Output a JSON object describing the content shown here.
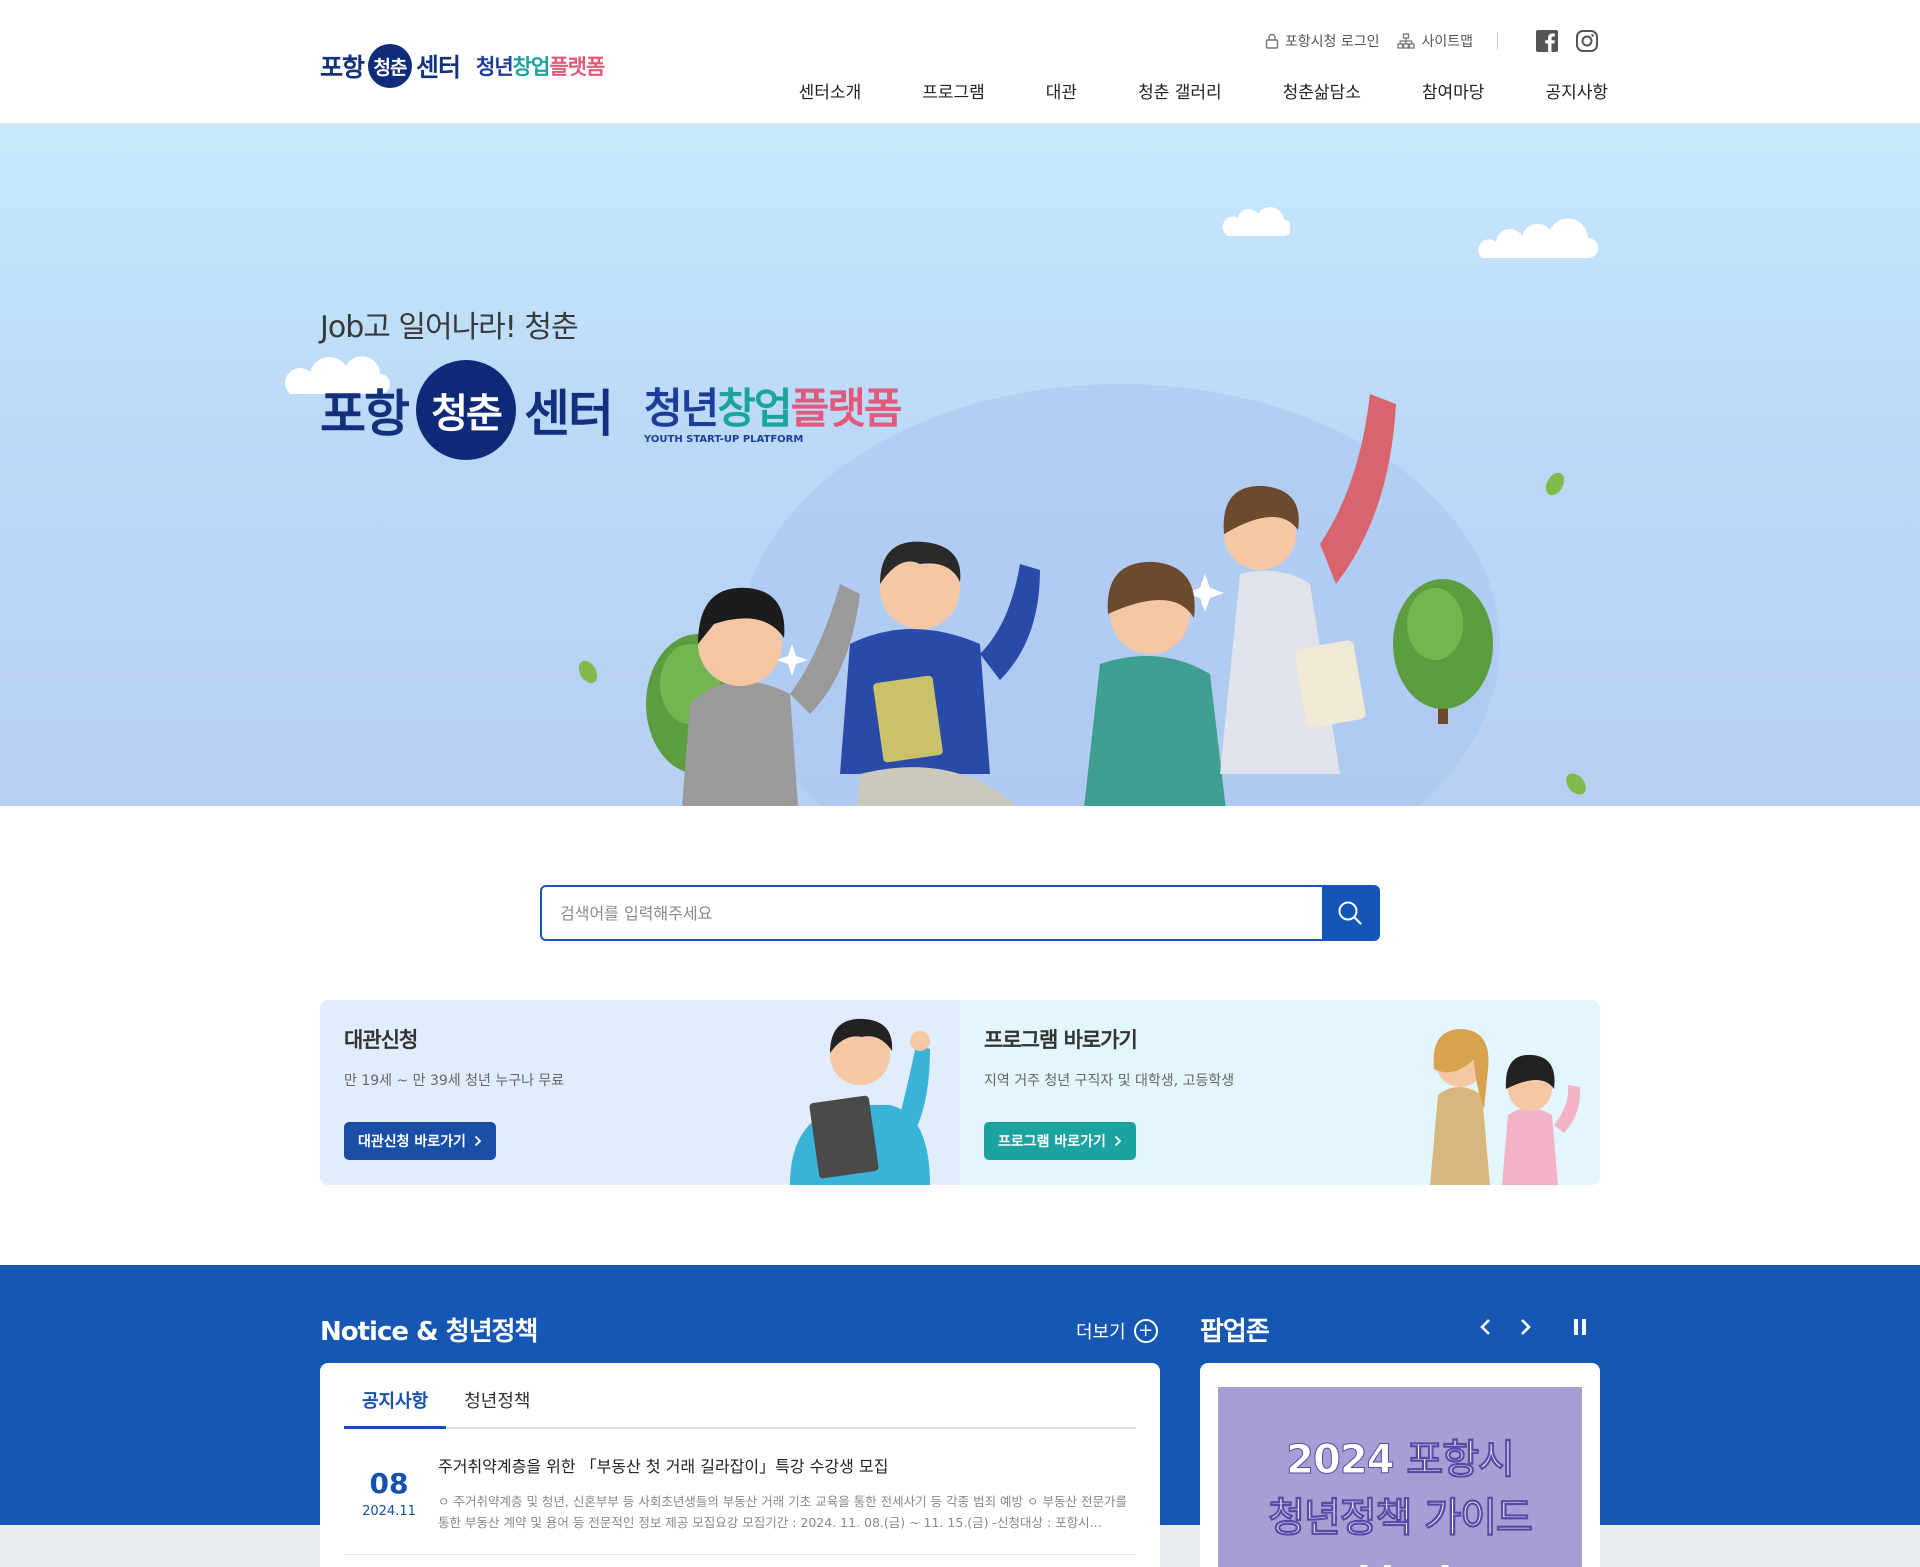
{
  "header": {
    "logo_main_left": "포항",
    "logo_main_circle": "청춘",
    "logo_main_right": "센터",
    "logo_sub_1": "청년",
    "logo_sub_2": "창업",
    "logo_sub_3": "플랫폼",
    "util_login": "포항시청 로그인",
    "util_sitemap": "사이트맵",
    "nav": [
      "센터소개",
      "프로그램",
      "대관",
      "청춘 갤러리",
      "청춘삶담소",
      "참여마당",
      "공지사항"
    ]
  },
  "hero": {
    "slogan": "Job고 일어나라! 청춘",
    "logo_left": "포항",
    "logo_circle": "청춘",
    "logo_right": "센터",
    "sub_1": "청년",
    "sub_2": "창업",
    "sub_3": "플랫폼",
    "sub_en": "YOUTH START-UP PLATFORM"
  },
  "search": {
    "placeholder": "검색어를 입력해주세요",
    "value": ""
  },
  "cards": [
    {
      "title": "대관신청",
      "desc": "만 19세 ~ 만 39세 청년 누구나 무료",
      "button": "대관신청 바로가기"
    },
    {
      "title": "프로그램 바로가기",
      "desc": "지역 거주 청년 구직자 및 대학생, 고등학생",
      "button": "프로그램 바로가기"
    }
  ],
  "notice": {
    "title": "Notice & 청년정책",
    "more": "더보기",
    "tabs": [
      "공지사항",
      "청년정책"
    ],
    "active_tab": "공지사항",
    "posts": [
      {
        "day": "08",
        "ym": "2024.11",
        "title": "주거취약계층을 위한 「부동산 첫 거래 길라잡이」특강 수강생 모집",
        "text": "ㅇ 주거취약계층 및 청년, 신혼부부 등 사회초년생들의 부동산 거래 기초 교육을 통한 전세사기 등 각종 범죄 예방 ㅇ 부동산 전문가를 통한 부동산 계약 및 용어 등 전문적인 정보 제공 모집요강 모집기간 : 2024. 11. 08.(금) ~ 11. 15.(금) -신청대상 : 포항시..."
      }
    ]
  },
  "popup": {
    "title": "팝업존",
    "banner_line1": "2024 포항시",
    "banner_line2": "청년정책 가이드",
    "banner_line3": "한없"
  },
  "colors": {
    "brand_navy": "#112b7b",
    "primary_blue": "#1557b3",
    "teal": "#1ba3a0",
    "pink": "#e25a7b"
  }
}
